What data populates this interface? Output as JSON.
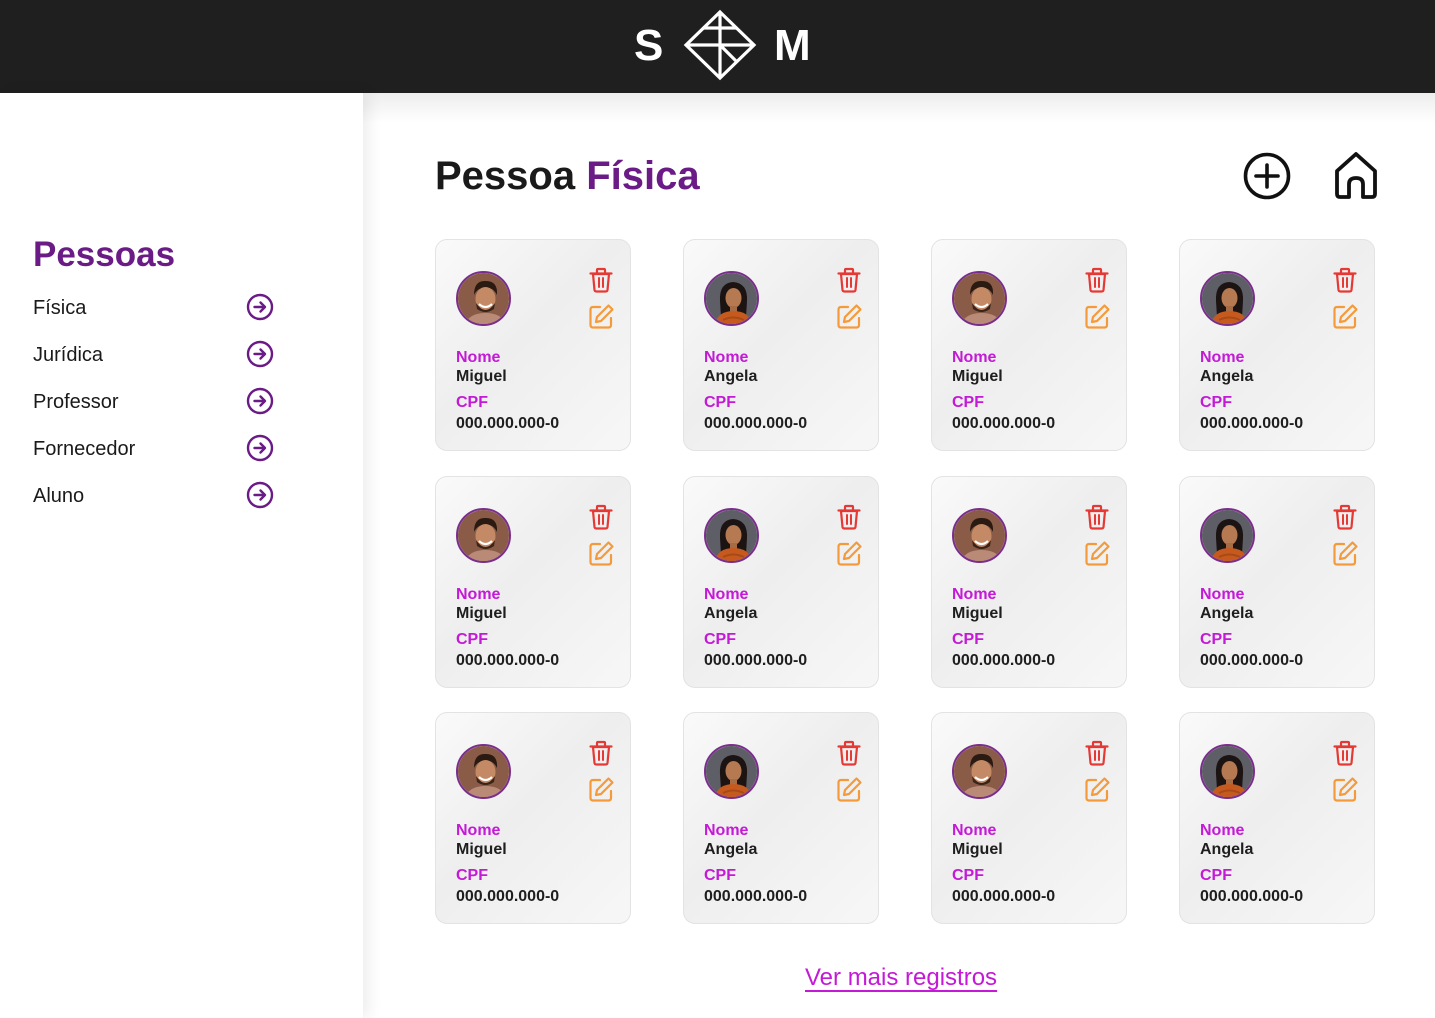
{
  "header": {
    "logo_left": "S",
    "logo_right": "M",
    "logo_icon": "diamond-logo-icon"
  },
  "sidebar": {
    "title": "Pessoas",
    "items": [
      {
        "label": "Física",
        "icon": "arrow-right-circle-icon"
      },
      {
        "label": "Jurídica",
        "icon": "arrow-right-circle-icon"
      },
      {
        "label": "Professor",
        "icon": "arrow-right-circle-icon"
      },
      {
        "label": "Fornecedor",
        "icon": "arrow-right-circle-icon"
      },
      {
        "label": "Aluno",
        "icon": "arrow-right-circle-icon"
      }
    ]
  },
  "main": {
    "title_prefix": "Pessoa",
    "title_accent": "Física",
    "add_icon": "plus-circle-icon",
    "home_icon": "home-icon",
    "name_label": "Nome",
    "cpf_label": "CPF",
    "cards": [
      {
        "name": "Miguel",
        "cpf": "000.000.000-0",
        "avatar": "male"
      },
      {
        "name": "Angela",
        "cpf": "000.000.000-0",
        "avatar": "female"
      },
      {
        "name": "Miguel",
        "cpf": "000.000.000-0",
        "avatar": "male"
      },
      {
        "name": "Angela",
        "cpf": "000.000.000-0",
        "avatar": "female"
      },
      {
        "name": "Miguel",
        "cpf": "000.000.000-0",
        "avatar": "male"
      },
      {
        "name": "Angela",
        "cpf": "000.000.000-0",
        "avatar": "female"
      },
      {
        "name": "Miguel",
        "cpf": "000.000.000-0",
        "avatar": "male"
      },
      {
        "name": "Angela",
        "cpf": "000.000.000-0",
        "avatar": "female"
      },
      {
        "name": "Miguel",
        "cpf": "000.000.000-0",
        "avatar": "male"
      },
      {
        "name": "Angela",
        "cpf": "000.000.000-0",
        "avatar": "female"
      },
      {
        "name": "Miguel",
        "cpf": "000.000.000-0",
        "avatar": "male"
      },
      {
        "name": "Angela",
        "cpf": "000.000.000-0",
        "avatar": "female"
      }
    ],
    "more_link": "Ver mais registros"
  },
  "colors": {
    "brand_purple": "#6a1b86",
    "label_magenta": "#c419d6",
    "delete_red": "#e53935",
    "edit_orange": "#f59a3a",
    "topbar": "#1f1f1f"
  }
}
